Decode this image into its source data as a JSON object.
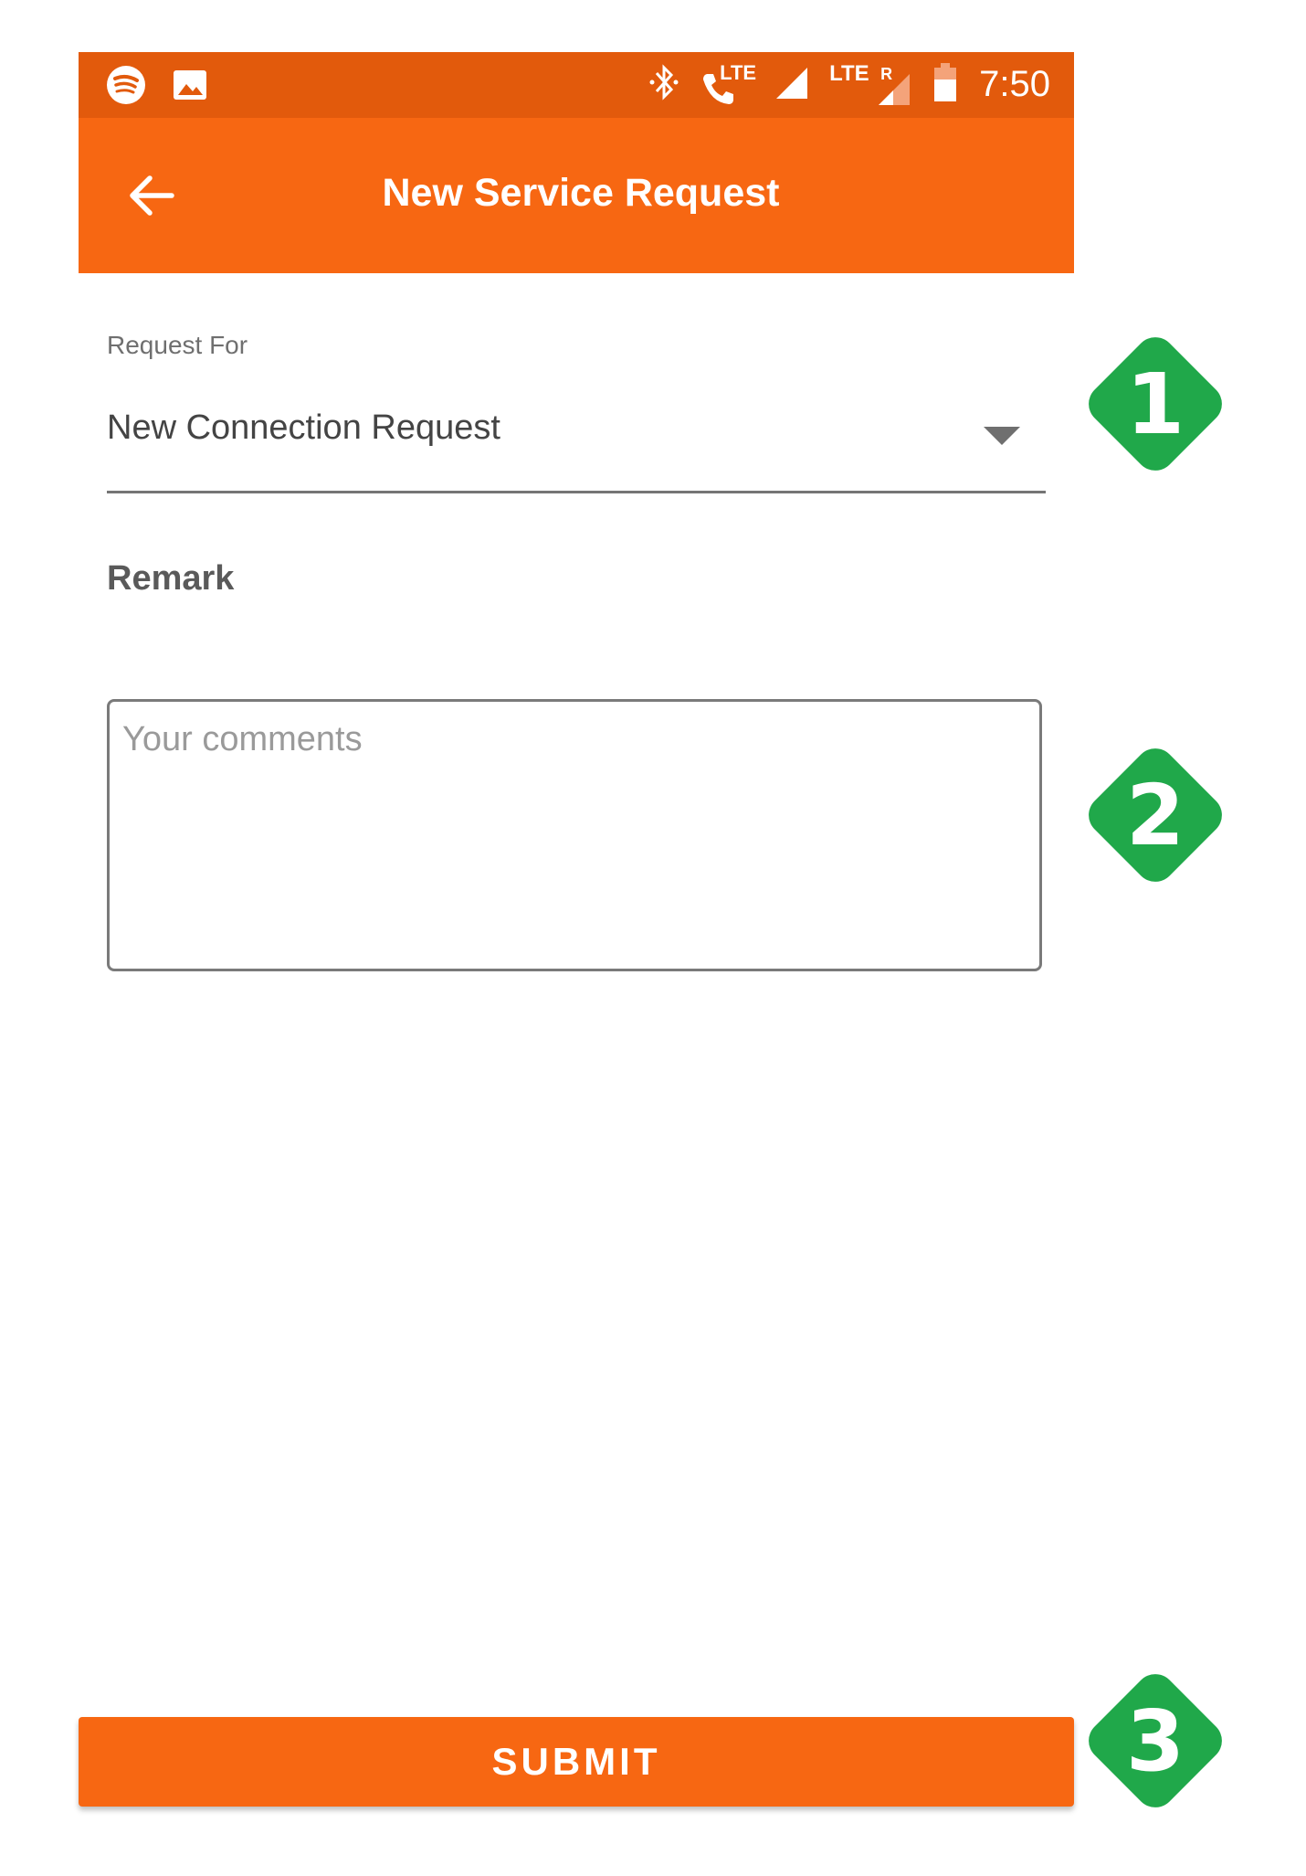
{
  "status_bar": {
    "time": "7:50",
    "lte_label_1": "LTE",
    "lte_label_2": "LTE",
    "roaming": "R",
    "icons": [
      "spotify-icon",
      "image-icon",
      "bluetooth-icon",
      "volte-call-icon",
      "signal-icon",
      "roaming-signal-icon",
      "battery-icon"
    ]
  },
  "app_bar": {
    "title": "New Service Request",
    "back_icon": "arrow-left-icon"
  },
  "form": {
    "request_for_label": "Request For",
    "request_for_value": "New Connection Request",
    "remark_label": "Remark",
    "comments_placeholder": "Your comments",
    "comments_value": ""
  },
  "actions": {
    "submit_label": "SUBMIT"
  },
  "markers": [
    "1",
    "2",
    "3"
  ],
  "colors": {
    "status_bar": "#E25A0C",
    "primary": "#F76712",
    "marker_green": "#20A84A"
  }
}
